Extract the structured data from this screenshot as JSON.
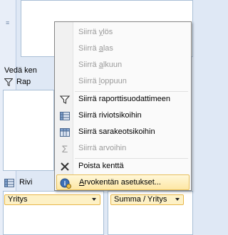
{
  "panel": {
    "drag_label": "Vedä ken",
    "report_filter_label": "Rap",
    "row_labels_label": "Rivi",
    "row_field": "Yritys",
    "value_field": "Summa / Yritys"
  },
  "menu": {
    "items": [
      {
        "pre": "Siirrä ",
        "key": "y",
        "post": "lös",
        "disabled": true
      },
      {
        "pre": "Siirrä ",
        "key": "a",
        "post": "las",
        "disabled": true
      },
      {
        "pre": "Siirrä ",
        "key": "a",
        "post": "lkuun",
        "disabled": true
      },
      {
        "pre": "Siirrä ",
        "key": "l",
        "post": "oppuun",
        "disabled": true
      },
      {
        "pre": "Siirrä raporttisuodattimeen",
        "key": "",
        "post": "",
        "disabled": false
      },
      {
        "pre": "Siirrä riviotsikoihin",
        "key": "",
        "post": "",
        "disabled": false
      },
      {
        "pre": "Siirrä sarakeotsikoihin",
        "key": "",
        "post": "",
        "disabled": false
      },
      {
        "pre": "Siirrä arvoihin",
        "key": "",
        "post": "",
        "disabled": true
      },
      {
        "pre": "Poista kenttä",
        "key": "",
        "post": "",
        "disabled": false
      },
      {
        "pre": "",
        "key": "A",
        "post": "rvokentän asetukset...",
        "disabled": false,
        "highlighted": true
      }
    ],
    "icons": [
      "filter-icon",
      "row-labels-icon",
      "column-labels-icon",
      "sigma-icon",
      "delete-icon",
      "field-settings-icon"
    ]
  }
}
